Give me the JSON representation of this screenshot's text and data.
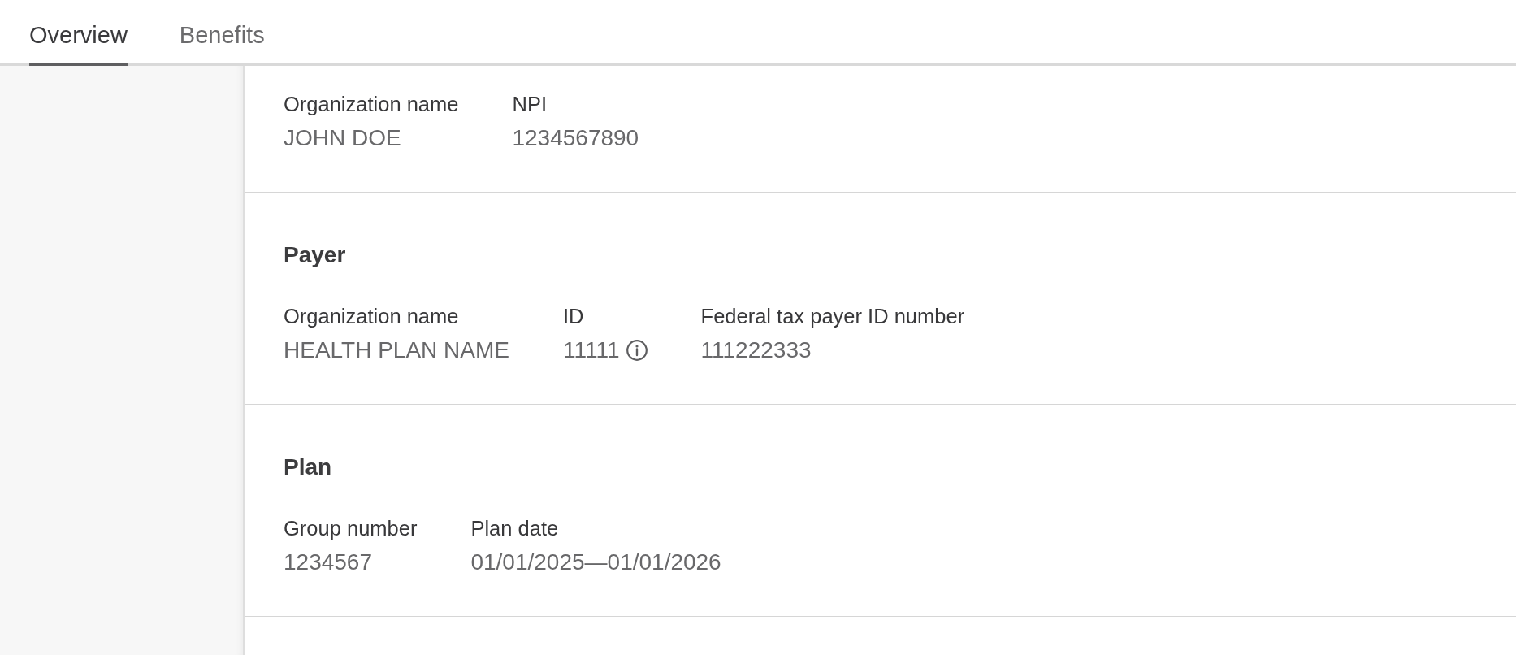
{
  "tabs": [
    {
      "label": "Overview",
      "selected": true
    },
    {
      "label": "Benefits",
      "selected": false
    }
  ],
  "sections": [
    {
      "fields": [
        {
          "label": "Organization name",
          "value": "JOHN DOE",
          "info": false
        },
        {
          "label": "NPI",
          "value": "1234567890",
          "info": false
        }
      ]
    },
    {
      "heading": "Payer",
      "fields": [
        {
          "label": "Organization name",
          "value": "HEALTH PLAN NAME",
          "info": false
        },
        {
          "label": "ID",
          "value": "11111",
          "info": true
        },
        {
          "label": "Federal tax payer ID number",
          "value": "111222333",
          "info": false
        }
      ]
    },
    {
      "heading": "Plan",
      "fields": [
        {
          "label": "Group number",
          "value": "1234567",
          "info": false
        },
        {
          "label": "Plan date",
          "value": "01/01/2025—01/01/2026",
          "info": false
        }
      ]
    }
  ]
}
